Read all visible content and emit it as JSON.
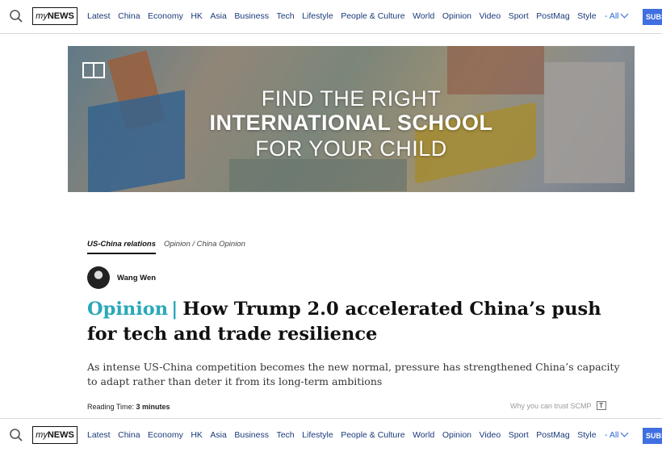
{
  "nav": {
    "brand": {
      "my": "my",
      "news": "NEWS"
    },
    "items": [
      "Latest",
      "China",
      "Economy",
      "HK",
      "Asia",
      "Business",
      "Tech",
      "Lifestyle",
      "People & Culture",
      "World",
      "Opinion",
      "Video",
      "Sport",
      "PostMag",
      "Style"
    ],
    "all_label": "- All",
    "subscribe_label": "SUBSCRIBE",
    "icons": {
      "search": "search-icon",
      "all": "chevron-down-icon"
    }
  },
  "banner": {
    "line1": "FIND THE RIGHT",
    "line2": "INTERNATIONAL SCHOOL",
    "line3": "FOR YOUR CHILD",
    "logo_icon": "book-icon"
  },
  "article": {
    "tag_main": "US-China relations",
    "tag_secondary": "Opinion / China Opinion",
    "author": "Wang Wen",
    "kicker": "Opinion",
    "separator": "|",
    "title": "How Trump 2.0 accelerated China’s push for tech and trade resilience",
    "summary": "As intense US-China competition becomes the new normal, pressure has strengthened China’s capacity to adapt rather than deter it from its long-term ambitions",
    "reading_label": "Reading Time:",
    "reading_value": "3 minutes",
    "trust_label": "Why you can trust SCMP",
    "trust_icon": "T"
  },
  "colors": {
    "accent": "#2aa8b8",
    "nav_text": "#1b3a7a",
    "subscribe_bg": "#3f6fe0"
  }
}
